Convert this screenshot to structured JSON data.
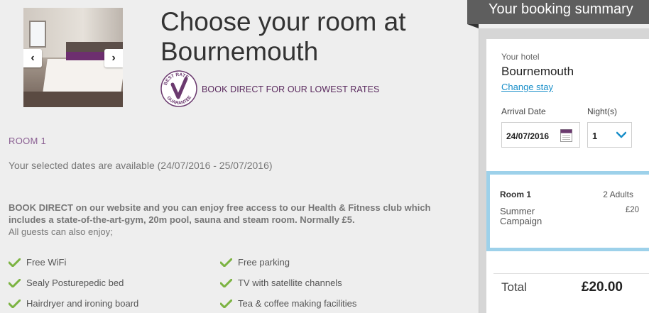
{
  "gallery": {
    "prev_label": "‹",
    "next_label": "›",
    "prev_icon": "chevron-left-icon",
    "next_icon": "chevron-right-icon"
  },
  "header": {
    "title": "Choose your room at Bournemouth"
  },
  "badge": {
    "top_text": "BEST RATE",
    "bottom_text": "GUARANTEE",
    "icon": "best-rate-guarantee-seal",
    "color": "#6b3a6f"
  },
  "rate_message": "BOOK DIRECT FOR OUR LOWEST RATES",
  "room": {
    "label": "ROOM 1",
    "availability": "Your selected dates are available (24/07/2016 - 25/07/2016)"
  },
  "promo": {
    "bold_text": "BOOK DIRECT on our website and you can enjoy free access to our Health & Fitness club which includes a state-of-the-art-gym, 20m pool, sauna and steam room. Normally £5.",
    "extra_text": "All guests can also enjoy;"
  },
  "amenities": [
    "Free WiFi",
    "Free parking",
    "Sealy Posturepedic bed",
    "TV with satellite channels",
    "Hairdryer and ironing board",
    "Tea & coffee making facilities"
  ],
  "summary": {
    "title": "Your booking summary",
    "hotel_label": "Your hotel",
    "hotel_name": "Bournemouth",
    "change_link": "Change stay",
    "arrival_label": "Arrival Date",
    "arrival_value": "24/07/2016",
    "nights_label": "Night(s)",
    "nights_value": "1",
    "room_line": {
      "room": "Room 1",
      "adults": "2 Adults",
      "campaign": "Summer Campaign",
      "price": "£20"
    },
    "total_label": "Total",
    "total_value": "£20.00"
  },
  "colors": {
    "accent_purple": "#6b3a6f",
    "link_blue": "#1a8fc9",
    "check_green": "#7cb342",
    "highlight_border": "#9dd1ea",
    "header_gray": "#5e5e5e"
  }
}
